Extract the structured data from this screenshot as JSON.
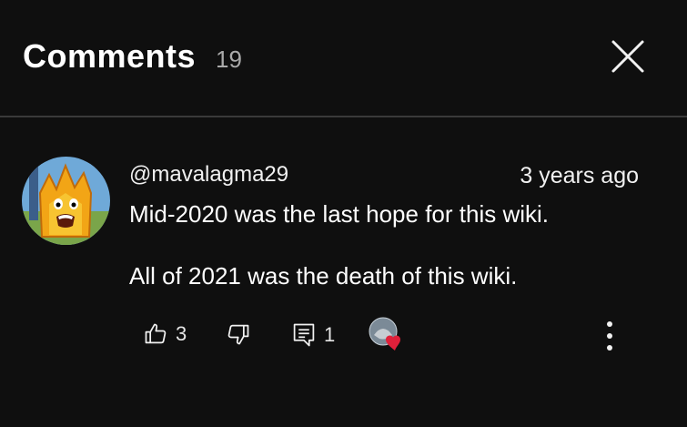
{
  "header": {
    "title": "Comments",
    "count": "19",
    "close_icon": "close-icon"
  },
  "comment": {
    "author": "@mavalagma29",
    "time": "3 years ago",
    "lines": [
      "Mid-2020 was the last hope for this wiki.",
      "All of 2021 was the death of this wiki."
    ],
    "likes": "3",
    "replies": "1",
    "icons": {
      "like": "thumbs-up-icon",
      "dislike": "thumbs-down-icon",
      "reply": "reply-icon",
      "hearted": "creator-heart-icon",
      "more": "more-vertical-icon"
    }
  },
  "colors": {
    "background": "#0f0f0f",
    "text": "#f1f1f1",
    "muted": "#aaaaaa",
    "divider": "#3a3a3a",
    "heart": "#e0203a"
  }
}
